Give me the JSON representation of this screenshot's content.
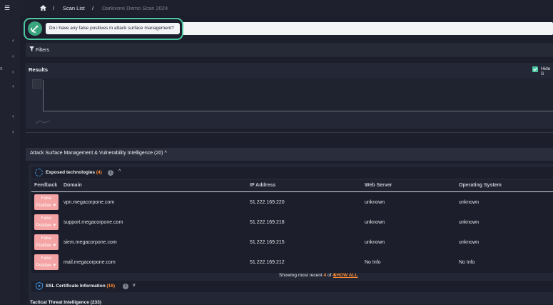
{
  "breadcrumb": {
    "home_icon": "home-icon",
    "sep1": "/",
    "scan_list": "Scan List",
    "sep2": "/",
    "current": "Darkivore Demo Scan 2024"
  },
  "sidebar": {
    "partial_label": "s",
    "chevron": "‹"
  },
  "chat": {
    "prompt": "Do i have any false positives in attack surface management?",
    "avatar_icon": "satellite-dish-icon",
    "accent": "#4bc6a0"
  },
  "filters": {
    "icon": "filter-icon",
    "label": "Filters"
  },
  "results": {
    "title": "Results",
    "hide_label": "Hide S"
  },
  "asm": {
    "title": "Attack Surface Management & Vulnerability Intelligence (20)",
    "chevron": "^",
    "exposed": {
      "title": "Exposed technologies",
      "count": "(4)",
      "info": "i",
      "chevron": "^"
    },
    "columns": [
      "Feedback",
      "Domain",
      "IP Address",
      "Web Server",
      "Operating System"
    ],
    "rows": [
      {
        "feedback": "False Positive ▼",
        "domain": "vpn.megacorpone.com",
        "ip": "51.222.169.220",
        "web_server": "unknown",
        "os": "unknown"
      },
      {
        "feedback": "False Positive ▼",
        "domain": "support.megacorpone.com",
        "ip": "51.222.169.218",
        "web_server": "unknown",
        "os": "unknown"
      },
      {
        "feedback": "False Positive ▼",
        "domain": "siem.megacorpone.com",
        "ip": "51.222.169.215",
        "web_server": "unknown",
        "os": "unknown"
      },
      {
        "feedback": "False Positive ▼",
        "domain": "mail.megacorpone.com",
        "ip": "51.222.169.212",
        "web_server": "No Info",
        "os": "No Info"
      }
    ],
    "showing": {
      "prefix": "Showing most recent",
      "shown": "4",
      "of": "of",
      "total": "4",
      "link": "SHOW ALL"
    },
    "ssl": {
      "title": "SSL Certificate Information",
      "count": "(16)",
      "info": "i",
      "chevron": "v"
    }
  },
  "bottom_partial": "Tactical Threat Intelligence (233)",
  "colors": {
    "accent_orange": "#ff8a33",
    "fp_button": "#f4a4a4",
    "green": "#4bc6a0"
  }
}
